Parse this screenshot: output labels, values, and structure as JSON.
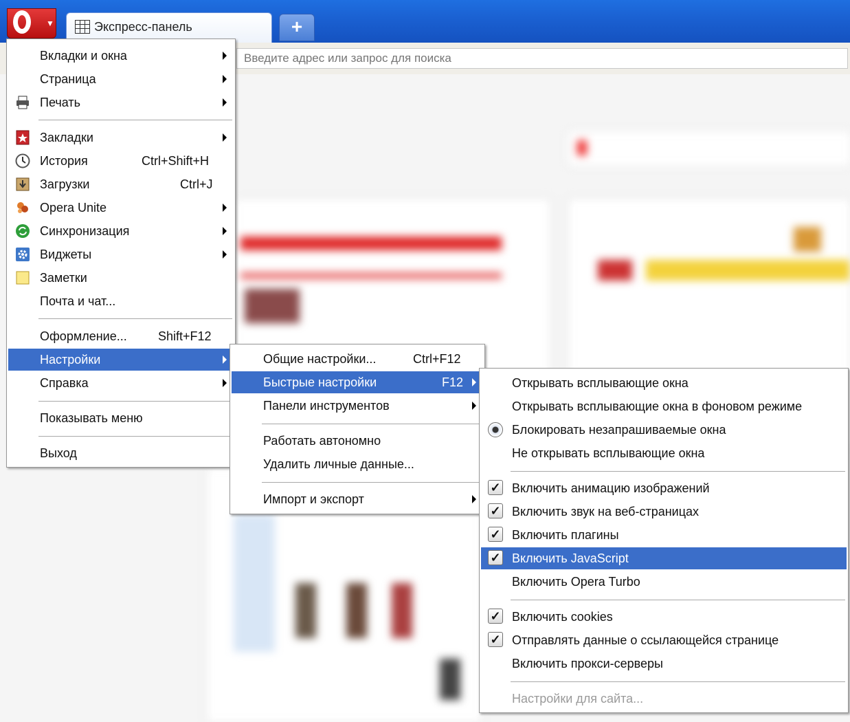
{
  "tab": {
    "label": "Экспресс-панель"
  },
  "address": {
    "placeholder": "Введите адрес или запрос для поиска"
  },
  "main_menu": [
    {
      "label": "Вкладки и окна",
      "submenu": true
    },
    {
      "label": "Страница",
      "submenu": true
    },
    {
      "label": "Печать",
      "submenu": true,
      "icon": "printer-icon"
    },
    {
      "label": "Закладки",
      "submenu": true,
      "icon": "bookmarks-icon"
    },
    {
      "label": "История",
      "shortcut": "Ctrl+Shift+H",
      "icon": "history-clock-icon"
    },
    {
      "label": "Загрузки",
      "shortcut": "Ctrl+J",
      "icon": "downloads-icon"
    },
    {
      "label": "Opera Unite",
      "submenu": true,
      "icon": "opera-unite-icon"
    },
    {
      "label": "Синхронизация",
      "submenu": true,
      "icon": "sync-icon"
    },
    {
      "label": "Виджеты",
      "submenu": true,
      "icon": "widgets-gear-icon"
    },
    {
      "label": "Заметки",
      "icon": "notes-icon"
    },
    {
      "label": "Почта и чат..."
    },
    {
      "label": "Оформление...",
      "shortcut": "Shift+F12"
    },
    {
      "label": "Настройки",
      "submenu": true,
      "selected": true
    },
    {
      "label": "Справка",
      "submenu": true
    },
    {
      "label": "Показывать меню"
    },
    {
      "label": "Выход"
    }
  ],
  "settings_menu": [
    {
      "label": "Общие настройки...",
      "shortcut": "Ctrl+F12"
    },
    {
      "label": "Быстрые настройки",
      "shortcut": "F12",
      "submenu": true,
      "selected": true
    },
    {
      "label": "Панели инструментов",
      "submenu": true
    },
    {
      "label": "Работать автономно"
    },
    {
      "label": "Удалить личные данные..."
    },
    {
      "label": "Импорт и экспорт",
      "submenu": true
    }
  ],
  "quick_menu": [
    {
      "label": "Открывать всплывающие окна",
      "radio": false
    },
    {
      "label": "Открывать всплывающие окна в фоновом режиме",
      "radio": false
    },
    {
      "label": "Блокировать незапрашиваемые окна",
      "radio": true
    },
    {
      "label": "Не открывать всплывающие окна",
      "radio": false
    },
    {
      "label": "Включить анимацию изображений",
      "checked": true
    },
    {
      "label": "Включить звук на веб-страницах",
      "checked": true
    },
    {
      "label": "Включить плагины",
      "checked": true
    },
    {
      "label": "Включить JavaScript",
      "checked": true,
      "selected": true
    },
    {
      "label": "Включить Opera Turbo",
      "checked": false
    },
    {
      "label": "Включить cookies",
      "checked": true
    },
    {
      "label": "Отправлять данные о ссылающейся странице",
      "checked": true
    },
    {
      "label": "Включить прокси-серверы",
      "checked": false
    },
    {
      "label": "Настройки для сайта...",
      "disabled": true
    }
  ],
  "colors": {
    "highlight": "#3b6ec9",
    "tabbar": "#1a5fd0",
    "opera_red": "#cc1b1b"
  },
  "glyphs": {
    "check": "✓"
  }
}
